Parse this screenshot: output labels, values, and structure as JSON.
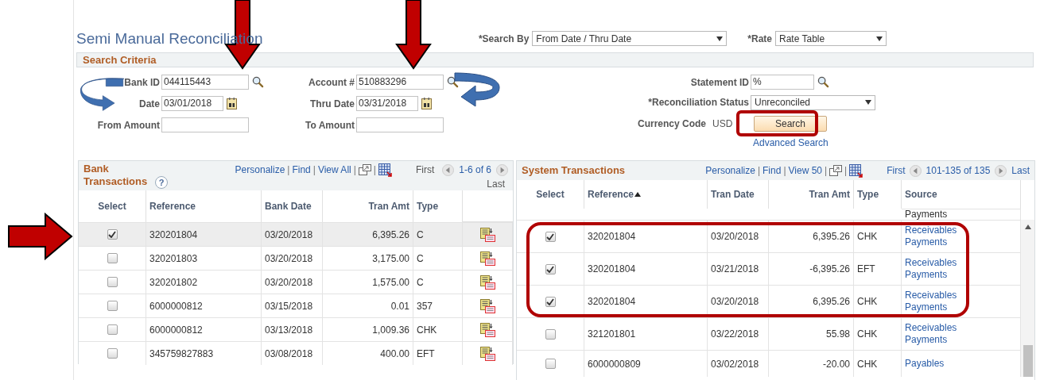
{
  "title": "Semi Manual Reconciliation",
  "search_by": {
    "label": "*Search By",
    "value": "From Date / Thru Date"
  },
  "rate": {
    "label": "*Rate",
    "value": "Rate Table"
  },
  "search_criteria": {
    "title": "Search Criteria",
    "column_1": [
      {
        "label": "Bank ID",
        "value": "044115443",
        "kind": "lookup"
      },
      {
        "label": "Date",
        "value": "03/01/2018",
        "kind": "date"
      },
      {
        "label": "From Amount",
        "kind": "text"
      }
    ],
    "column_2": [
      {
        "label": "Account #",
        "value": "510883296",
        "kind": "lookup"
      },
      {
        "label": "Thru Date",
        "value": "03/31/2018",
        "kind": "date"
      },
      {
        "label": "To Amount",
        "kind": "text"
      }
    ],
    "statement_id": {
      "label": "Statement ID",
      "value": "%"
    },
    "reconciliation_status": {
      "label": "*Reconciliation Status",
      "value": "Unreconciled"
    },
    "currency_code": {
      "label": "Currency Code",
      "value": "USD"
    },
    "search_button": "Search",
    "advanced_search": "Advanced Search"
  },
  "bank_transactions": {
    "title": "Bank Transactions",
    "help": "?",
    "separator": "|",
    "links": [
      "Personalize",
      "Find",
      "View All"
    ],
    "first": "First",
    "range": "1-6 of 6",
    "last": "Last",
    "columns": [
      "Select",
      "Reference",
      "Bank Date",
      "Tran Amt",
      "Type"
    ],
    "rows": [
      {
        "selected": true,
        "reference": "320201804",
        "date": "03/20/2018",
        "amount": "6,395.26",
        "type": "C"
      },
      {
        "selected": false,
        "reference": "320201803",
        "date": "03/20/2018",
        "amount": "3,175.00",
        "type": "C"
      },
      {
        "selected": false,
        "reference": "320201802",
        "date": "03/20/2018",
        "amount": "1,575.00",
        "type": "C"
      },
      {
        "selected": false,
        "reference": "6000000812",
        "date": "03/15/2018",
        "amount": "0.01",
        "type": "357"
      },
      {
        "selected": false,
        "reference": "6000000812",
        "date": "03/13/2018",
        "amount": "1,009.36",
        "type": "CHK"
      },
      {
        "selected": false,
        "reference": "345759827883",
        "date": "03/08/2018",
        "amount": "400.00",
        "type": "EFT"
      }
    ]
  },
  "system_transactions": {
    "title": "System Transactions",
    "separator": "|",
    "links": [
      "Personalize",
      "Find",
      "View 50"
    ],
    "first": "First",
    "range": "101-135 of 135",
    "last": "Last",
    "columns": [
      "Select",
      "Reference",
      "Tran Date",
      "Tran Amt",
      "Type",
      "Source"
    ],
    "partial_row_source": "Payments",
    "rows": [
      {
        "selected": true,
        "reference": "320201804",
        "date": "03/20/2018",
        "amount": "6,395.26",
        "type": "CHK",
        "source": [
          "Receivables",
          "Payments"
        ]
      },
      {
        "selected": true,
        "reference": "320201804",
        "date": "03/21/2018",
        "amount": "-6,395.26",
        "type": "EFT",
        "source": [
          "Receivables",
          "Payments"
        ]
      },
      {
        "selected": true,
        "reference": "320201804",
        "date": "03/20/2018",
        "amount": "6,395.26",
        "type": "CHK",
        "source": [
          "Receivables",
          "Payments"
        ]
      },
      {
        "selected": false,
        "reference": "321201801",
        "date": "03/22/2018",
        "amount": "55.98",
        "type": "CHK",
        "source": [
          "Receivables",
          "Payments"
        ]
      },
      {
        "selected": false,
        "reference": "6000000809",
        "date": "03/02/2018",
        "amount": "-20.00",
        "type": "CHK",
        "source": [
          "Payables"
        ]
      }
    ]
  }
}
